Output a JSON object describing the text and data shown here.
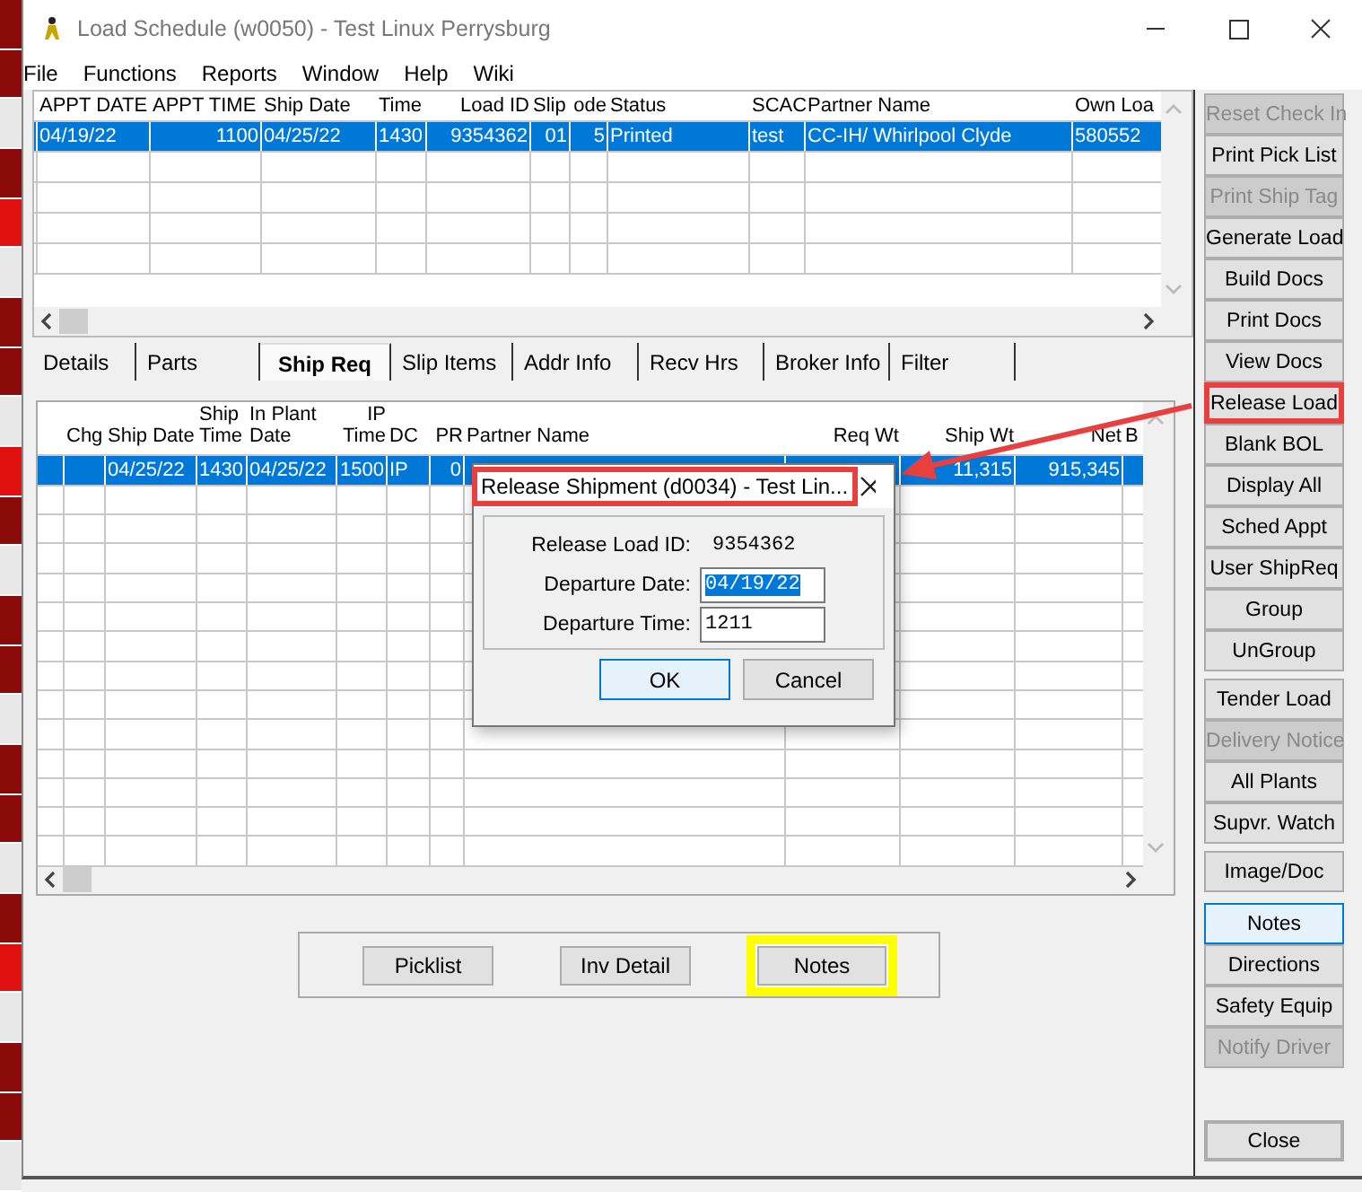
{
  "window": {
    "title": "Load Schedule (w0050) - Test Linux Perrysburg"
  },
  "menu": [
    "File",
    "Functions",
    "Reports",
    "Window",
    "Help",
    "Wiki"
  ],
  "top_grid": {
    "columns": [
      "APPT DATE",
      "APPT TIME",
      "Ship Date",
      "Time",
      "Load ID",
      "Slip",
      "ode",
      "Status",
      "SCAC",
      "Partner Name",
      "Own Loa"
    ],
    "rows": [
      {
        "selected": true,
        "cells": [
          "04/19/22",
          "1100",
          "04/25/22",
          "1430",
          "9354362",
          "01",
          "5",
          "Printed",
          "test",
          "CC-IH/ Whirlpool Clyde",
          "580552"
        ]
      }
    ]
  },
  "tabs": [
    {
      "label": "Details",
      "selected": false
    },
    {
      "label": "Parts",
      "selected": false
    },
    {
      "label": "Ship Req",
      "selected": true
    },
    {
      "label": "Slip Items",
      "selected": false
    },
    {
      "label": "Addr Info",
      "selected": false
    },
    {
      "label": "Recv Hrs",
      "selected": false
    },
    {
      "label": "Broker Info",
      "selected": false
    },
    {
      "label": "Filter",
      "selected": false
    }
  ],
  "ship_req_grid": {
    "columns": [
      "",
      "Chg",
      "Ship Date",
      "Ship Time",
      "In Plant Date",
      "IP Time",
      "DC",
      "PR",
      "Partner Name",
      "Req Wt",
      "Ship Wt",
      "Net",
      "B"
    ],
    "rows": [
      {
        "selected": true,
        "cells": [
          "",
          "",
          "04/25/22",
          "1430",
          "04/25/22",
          "1500",
          "IP",
          "0",
          "",
          "",
          "11,315",
          "915,345",
          ""
        ]
      }
    ]
  },
  "bottom_buttons": [
    {
      "label": "Picklist",
      "highlighted": false
    },
    {
      "label": "Inv Detail",
      "highlighted": false
    },
    {
      "label": "Notes",
      "highlighted": true
    }
  ],
  "side_button_groups": [
    [
      {
        "label": "Reset Check In",
        "disabled": true,
        "focused": false,
        "highlighted": false
      },
      {
        "label": "Print Pick List",
        "disabled": false,
        "focused": false,
        "highlighted": false
      },
      {
        "label": "Print Ship Tag",
        "disabled": true,
        "focused": false,
        "highlighted": false
      },
      {
        "label": "Generate Load",
        "disabled": false,
        "focused": false,
        "highlighted": false
      },
      {
        "label": "Build Docs",
        "disabled": false,
        "focused": false,
        "highlighted": false
      },
      {
        "label": "Print Docs",
        "disabled": false,
        "focused": false,
        "highlighted": false
      },
      {
        "label": "View Docs",
        "disabled": false,
        "focused": false,
        "highlighted": false
      },
      {
        "label": "Release Load",
        "disabled": false,
        "focused": false,
        "highlighted": true
      },
      {
        "label": "Blank BOL",
        "disabled": false,
        "focused": false,
        "highlighted": false
      },
      {
        "label": "Display All",
        "disabled": false,
        "focused": false,
        "highlighted": false
      },
      {
        "label": "Sched Appt",
        "disabled": false,
        "focused": false,
        "highlighted": false
      },
      {
        "label": "User ShipReq",
        "disabled": false,
        "focused": false,
        "highlighted": false
      },
      {
        "label": "Group",
        "disabled": false,
        "focused": false,
        "highlighted": false
      },
      {
        "label": "UnGroup",
        "disabled": false,
        "focused": false,
        "highlighted": false
      }
    ],
    [
      {
        "label": "Tender Load",
        "disabled": false,
        "focused": false,
        "highlighted": false
      },
      {
        "label": "Delivery Notice",
        "disabled": true,
        "focused": false,
        "highlighted": false
      },
      {
        "label": "All Plants",
        "disabled": false,
        "focused": false,
        "highlighted": false
      },
      {
        "label": "Supvr. Watch",
        "disabled": false,
        "focused": false,
        "highlighted": false
      }
    ],
    [
      {
        "label": "Image/Doc",
        "disabled": false,
        "focused": false,
        "highlighted": false
      }
    ],
    [
      {
        "label": "Notes",
        "disabled": false,
        "focused": true,
        "highlighted": false
      },
      {
        "label": "Directions",
        "disabled": false,
        "focused": false,
        "highlighted": false
      },
      {
        "label": "Safety Equip",
        "disabled": false,
        "focused": false,
        "highlighted": false
      },
      {
        "label": "Notify Driver",
        "disabled": true,
        "focused": false,
        "highlighted": false
      }
    ]
  ],
  "close_button": {
    "label": "Close"
  },
  "dialog": {
    "title": "Release Shipment (d0034) - Test Lin...",
    "title_highlighted": true,
    "fields": [
      {
        "kind": "readonly",
        "label": "Release Load ID:",
        "value": "9354362"
      },
      {
        "kind": "input",
        "label": "Departure Date:",
        "value": "04/19/22",
        "selected": true
      },
      {
        "kind": "input",
        "label": "Departure Time:",
        "value": "1211",
        "selected": false
      }
    ],
    "buttons": [
      {
        "label": "OK",
        "focused": true
      },
      {
        "label": "Cancel",
        "focused": false
      }
    ]
  }
}
